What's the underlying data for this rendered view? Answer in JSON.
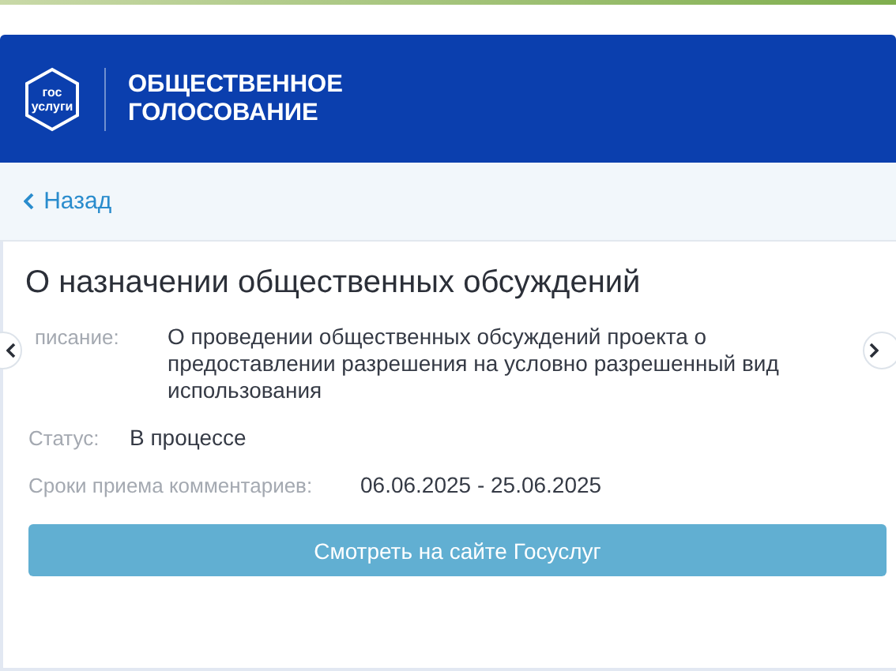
{
  "header": {
    "logo_text": [
      "гос",
      "услуги"
    ],
    "title_lines": [
      "ОБЩЕСТВЕННОЕ",
      "ГОЛОСОВАНИЕ"
    ]
  },
  "back_link": {
    "label": "Назад"
  },
  "card": {
    "title": "О назначении общественных обсуждений",
    "fields": [
      {
        "label": "писание:",
        "value": "О проведении общественных обсуждений проекта о предоставлении разрешения на условно разрешенный вид использования"
      },
      {
        "label": "Статус:",
        "value": "В процессе"
      },
      {
        "label": "Сроки приема комментариев:",
        "value": "06.06.2025 - 25.06.2025"
      }
    ],
    "button": {
      "label": "Смотреть на сайте Госуслуг"
    }
  }
}
